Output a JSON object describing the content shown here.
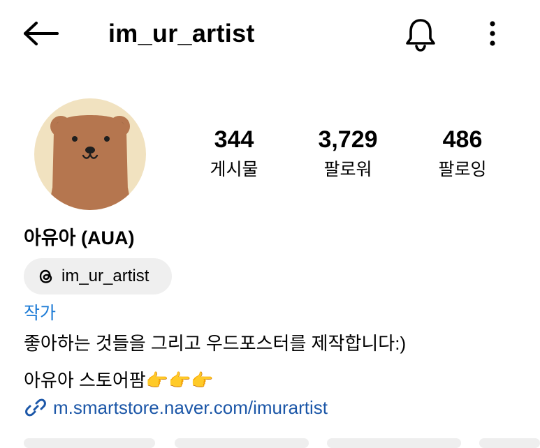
{
  "header": {
    "username": "im_ur_artist",
    "back_icon": "arrow-left-icon",
    "notification_icon": "bell-icon",
    "menu_icon": "vertical-dots-icon"
  },
  "profile": {
    "avatar_icon": "bear-avatar",
    "stats": [
      {
        "value": "344",
        "label": "게시물"
      },
      {
        "value": "3,729",
        "label": "팔로워"
      },
      {
        "value": "486",
        "label": "팔로잉"
      }
    ],
    "display_name": "아유아 (AUA)",
    "threads_handle": "im_ur_artist",
    "threads_icon": "threads-icon",
    "category": "작가",
    "bio": {
      "line1": "좋아하는 것들을 그리고 우드포스터를 제작합니다:)",
      "line2": "아유아 스토어팜👉👉👉"
    },
    "link": {
      "icon": "link-icon",
      "text": "m.smartstore.naver.com/imurartist"
    }
  },
  "colors": {
    "accent_blue": "#1c7bd6",
    "link_blue": "#1c57a8",
    "chip_bg": "#efefef",
    "avatar_bg": "#f1e2c0",
    "bear_brown": "#b5764f"
  }
}
